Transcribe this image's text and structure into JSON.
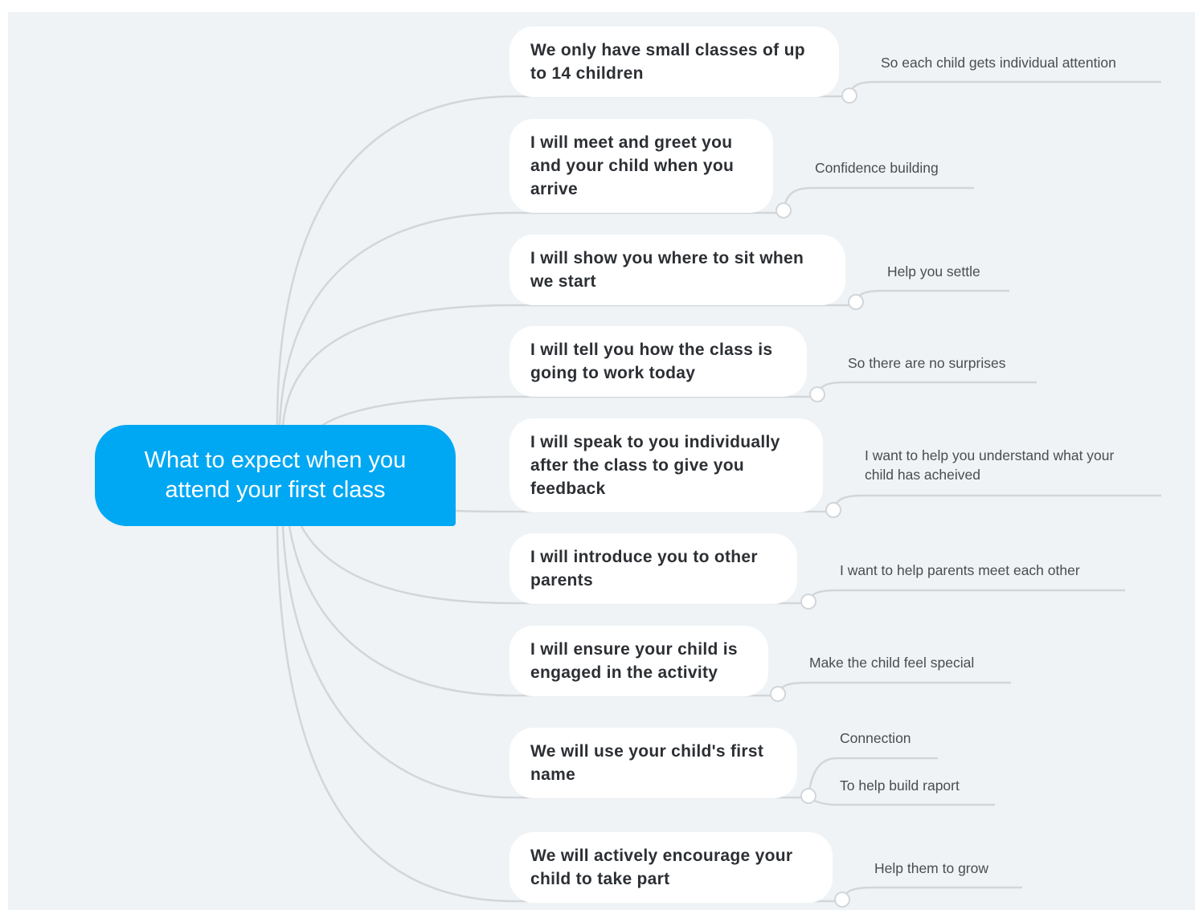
{
  "central_topic": "What to expect when you\nattend your first class",
  "branches": [
    {
      "topic": "We only have small classes of up\nto 14 children",
      "notes": [
        "So each child gets individual attention"
      ]
    },
    {
      "topic": "I will meet and greet you\nand your child when you\narrive",
      "notes": [
        "Confidence building"
      ]
    },
    {
      "topic": "I will show you where to sit when\nwe start",
      "notes": [
        "Help you settle"
      ]
    },
    {
      "topic": "I will tell you how the class is\ngoing to work today",
      "notes": [
        "So there are no surprises"
      ]
    },
    {
      "topic": "I will speak to you individually\nafter the class to give you\nfeedback",
      "notes": [
        "I want to help you understand what your\nchild has acheived"
      ]
    },
    {
      "topic": "I will introduce you to other\nparents",
      "notes": [
        "I want to help parents meet each other"
      ]
    },
    {
      "topic": "I will ensure your child is\nengaged in the activity",
      "notes": [
        "Make the child feel special"
      ]
    },
    {
      "topic": "We will use your child's first\nname",
      "notes": [
        "Connection",
        "To help build raport"
      ]
    },
    {
      "topic": "We will actively encourage your\nchild to take part",
      "notes": [
        "Help them to grow"
      ]
    }
  ],
  "colors": {
    "central": "#00a8f3",
    "background": "#eff3f5",
    "connector": "#d2d6d9",
    "topic_fill": "#ffffff"
  }
}
